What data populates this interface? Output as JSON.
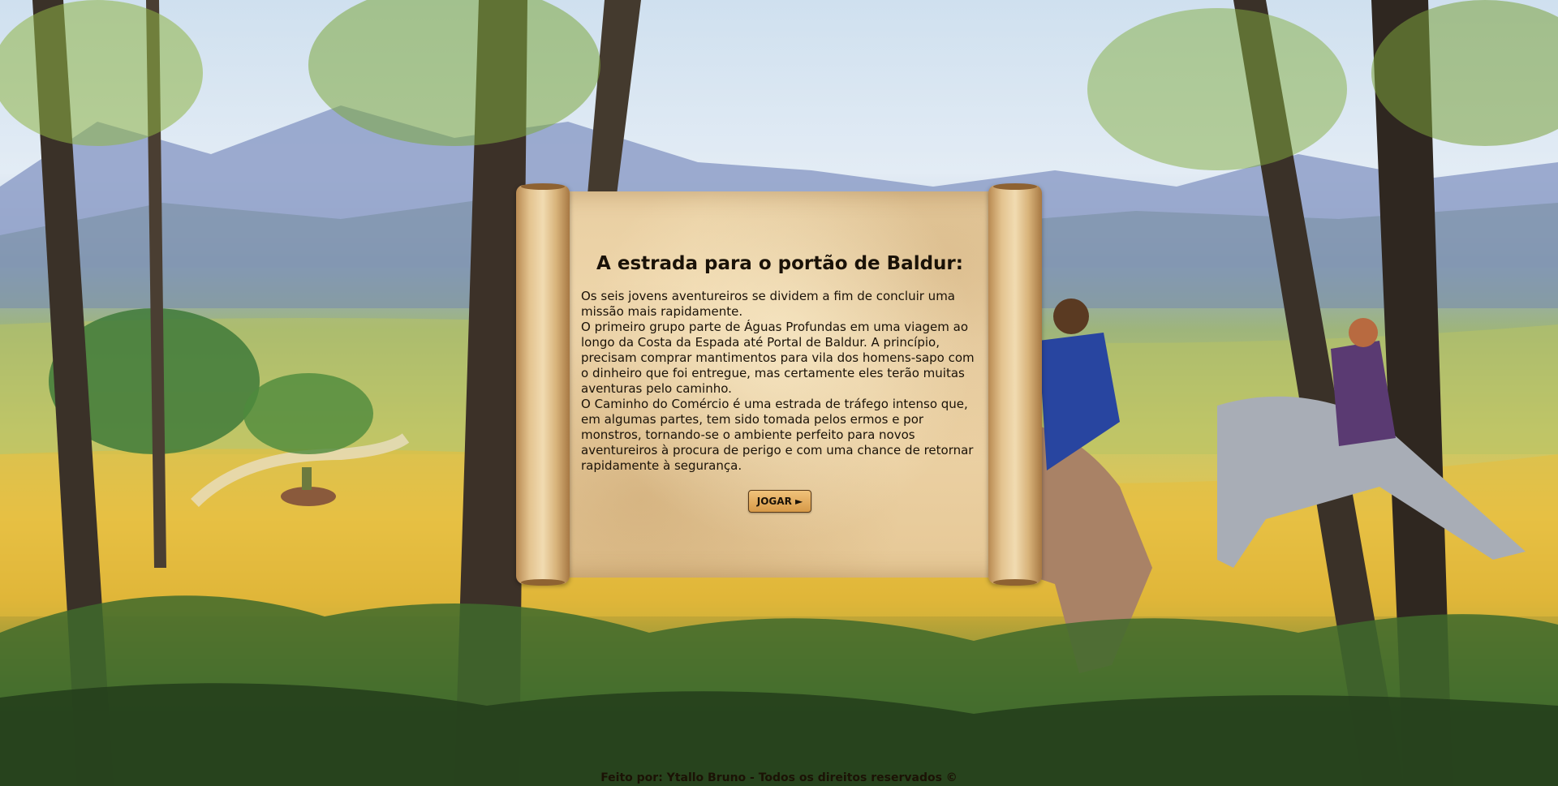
{
  "scroll": {
    "title": "A estrada para o portão de Baldur:",
    "paragraphs": [
      "Os seis jovens aventureiros se dividem a fim de concluir uma missão mais rapidamente.",
      "O primeiro grupo parte de Águas Profundas em uma viagem ao longo da Costa da Espada até Portal de Baldur. A princípio, precisam comprar mantimentos para vila dos homens-sapo com o dinheiro que foi entregue, mas certamente eles terão muitas aventuras pelo caminho.",
      "O Caminho do Comércio é uma estrada de tráfego intenso que, em algumas partes, tem sido tomada pelos ermos e por monstros, tornando-se o ambiente perfeito para novos aventureiros à procura de perigo e com uma chance de retornar rapidamente à segurança."
    ],
    "play_label": "JOGAR ►"
  },
  "footer": {
    "text": "Feito por: Ytallo Bruno - Todos os direitos reservados ©"
  },
  "colors": {
    "parchment": "#efd7ad",
    "button": "#e0a95a",
    "text": "#1a1208"
  }
}
